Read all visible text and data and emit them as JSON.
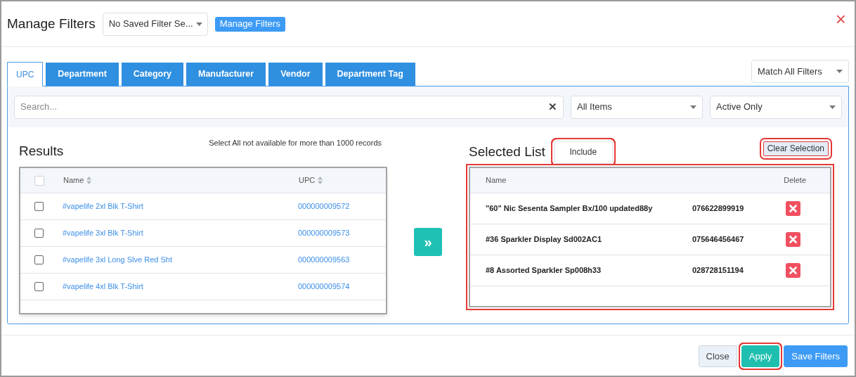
{
  "header": {
    "title": "Manage Filters",
    "saved_filter": "No Saved Filter Se...",
    "manage_button": "Manage Filters",
    "close_icon": "×"
  },
  "tabs": [
    {
      "label": "UPC",
      "selected": true
    },
    {
      "label": "Department",
      "selected": false
    },
    {
      "label": "Category",
      "selected": false
    },
    {
      "label": "Manufacturer",
      "selected": false
    },
    {
      "label": "Vendor",
      "selected": false
    },
    {
      "label": "Department Tag",
      "selected": false
    }
  ],
  "match_select": "Match All Filters",
  "search": {
    "placeholder": "Search...",
    "clear": "✕"
  },
  "item_select": "All Items",
  "status_select": "Active Only",
  "results": {
    "title": "Results",
    "note": "Select All not available for more than 1000 records",
    "columns": [
      "Name",
      "UPC"
    ],
    "select_all_checked": false,
    "rows": [
      {
        "name": "#vapelife 2xl Blk T-Shirt",
        "upc": "000000009572",
        "checked": false
      },
      {
        "name": "#vapelife 3xl Blk T-Shirt",
        "upc": "000000009573",
        "checked": false
      },
      {
        "name": "#vapelife 3xl Long Slve Red Sht",
        "upc": "000000009563",
        "checked": false
      },
      {
        "name": "#vapelife 4xl Blk T-Shirt",
        "upc": "000000009574",
        "checked": false
      }
    ]
  },
  "move_button": "»",
  "selected_list": {
    "title": "Selected List",
    "mode": "Include",
    "mode_annotated": true,
    "clear_button": "Clear Selection",
    "clear_annotated": true,
    "table_annotated": true,
    "columns": [
      "Name",
      "Delete"
    ],
    "rows": [
      {
        "name": "\"60\" Nic Sesenta Sampler Bx/100 updated88y",
        "upc": "076622899919"
      },
      {
        "name": "#36 Sparkler Display Sd002AC1",
        "upc": "075646456467"
      },
      {
        "name": "#8 Assorted Sparkler Sp008h33",
        "upc": "028728151194"
      }
    ]
  },
  "footer": {
    "buttons": [
      {
        "label": "Close",
        "kind": "secondary",
        "annotated": false
      },
      {
        "label": "Apply",
        "kind": "success",
        "annotated": true
      },
      {
        "label": "Save Filters",
        "kind": "primary",
        "annotated": false
      }
    ]
  }
}
